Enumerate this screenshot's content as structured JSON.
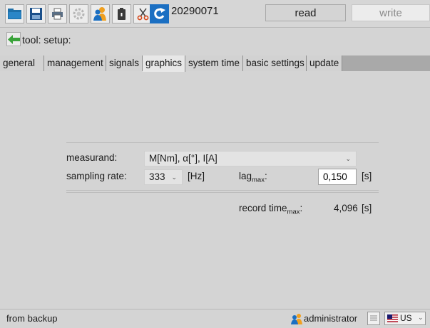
{
  "toolbar": {
    "title": "20290071",
    "read_label": "read",
    "write_label": "write",
    "icons": [
      "folder-icon",
      "save-icon",
      "print-icon",
      "gear-icon",
      "user-icon",
      "battery-icon",
      "scissors-icon",
      "refresh-icon"
    ]
  },
  "breadcrumb": {
    "label": "tool: setup:"
  },
  "tabs": [
    {
      "label": "general"
    },
    {
      "label": "management"
    },
    {
      "label": "signals"
    },
    {
      "label": "graphics",
      "active": true
    },
    {
      "label": "system time"
    },
    {
      "label": "basic settings"
    },
    {
      "label": "update"
    }
  ],
  "form": {
    "measurand_label": "measurand:",
    "measurand_value": "M[Nm], α[°], I[A]",
    "sampling_label": "sampling rate:",
    "sampling_value": "333",
    "sampling_unit": "[Hz]",
    "lag_label_base": "lag",
    "lag_label_sub": "max",
    "lag_label_colon": ":",
    "lag_value": "0,150",
    "lag_unit": "[s]",
    "record_label_base": "record time",
    "record_label_sub": "max",
    "record_label_colon": ":",
    "record_value": "4,096",
    "record_unit": "[s]"
  },
  "status": {
    "text": "from backup",
    "user": "administrator",
    "language": "US"
  },
  "colors": {
    "accent_green": "#3aa33a",
    "accent_blue": "#1b8ad6",
    "accent_orange": "#f0a020"
  }
}
